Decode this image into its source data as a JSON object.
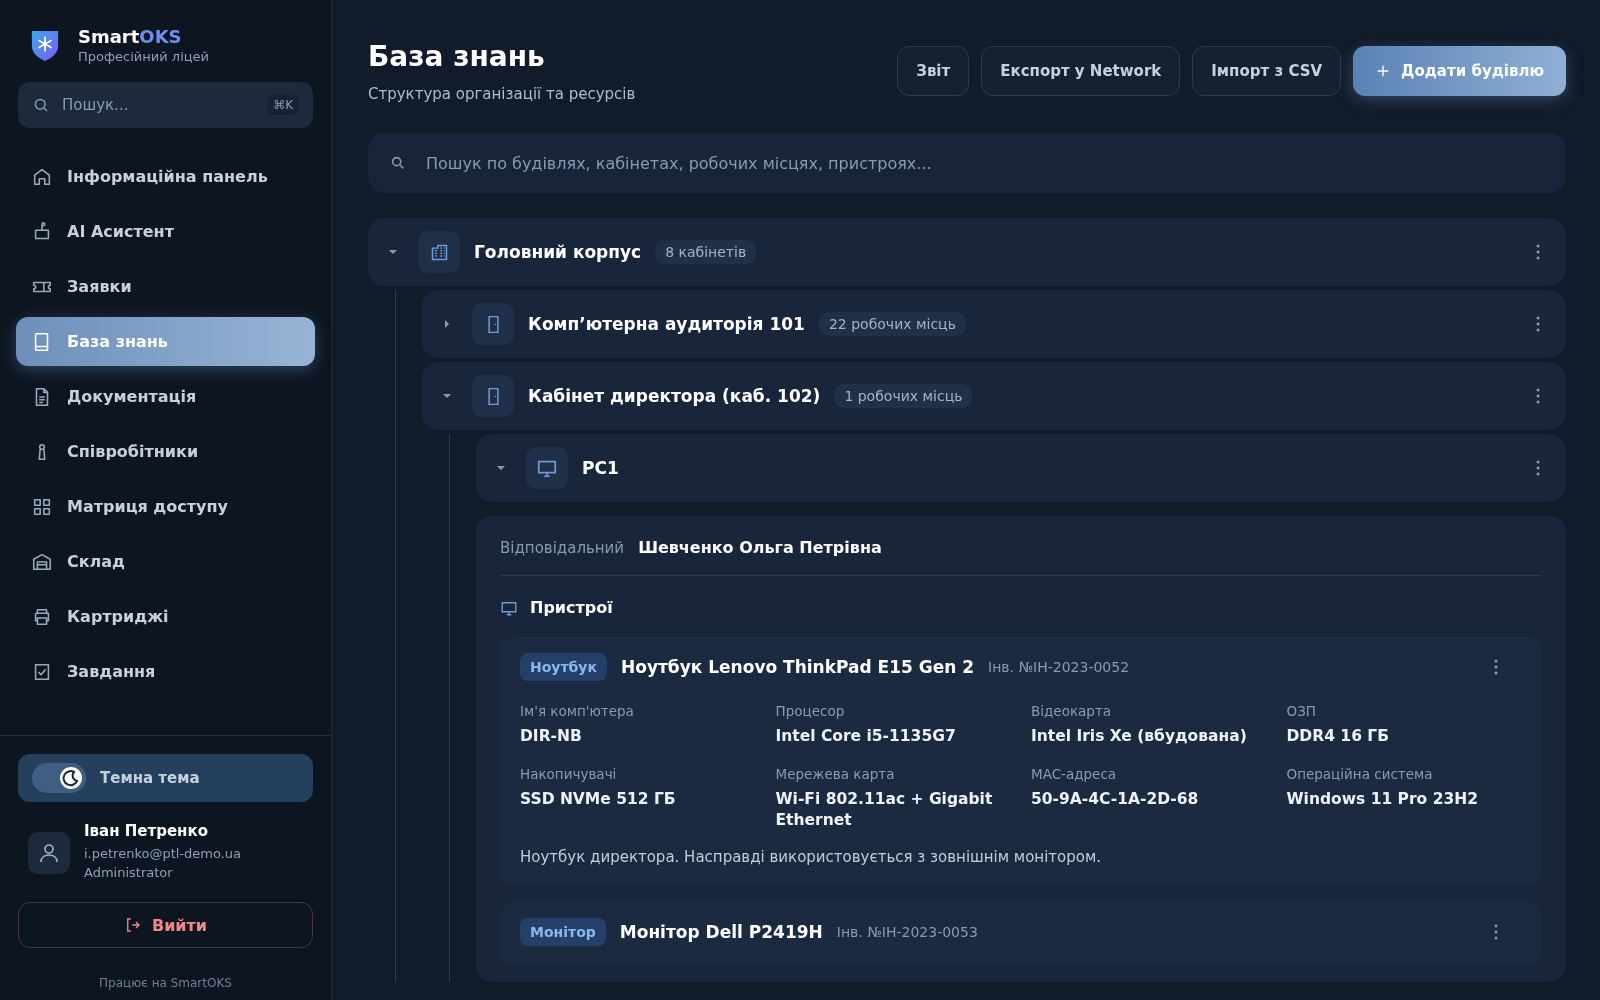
{
  "sidebar": {
    "brand": {
      "name": "Smart",
      "accent": "OKS",
      "subtitle": "Професійний ліцей"
    },
    "search": {
      "placeholder": "Пошук...",
      "shortcut": "⌘K"
    },
    "nav": [
      {
        "label": "Інформаційна панель",
        "selected": false
      },
      {
        "label": "AI Асистент",
        "selected": false
      },
      {
        "label": "Заявки",
        "selected": false
      },
      {
        "label": "База знань",
        "selected": true
      },
      {
        "label": "Документація",
        "selected": false
      },
      {
        "label": "Співробітники",
        "selected": false
      },
      {
        "label": "Матриця доступу",
        "selected": false
      },
      {
        "label": "Склад",
        "selected": false
      },
      {
        "label": "Картриджі",
        "selected": false
      },
      {
        "label": "Завдання",
        "selected": false
      }
    ],
    "theme_toggle": {
      "label": "Темна тема",
      "on": true
    },
    "user": {
      "name": "Іван Петренко",
      "email": "i.petrenko@ptl-demo.ua",
      "role": "Administrator"
    },
    "logout": "Вийти",
    "footer": "Працює на SmartOKS"
  },
  "header": {
    "title": "База знань",
    "subtitle": "Структура організації та ресурсів",
    "buttons": [
      {
        "label": "Звіт",
        "primary": false
      },
      {
        "label": "Експорт у Network",
        "primary": false
      },
      {
        "label": "Імпорт з CSV",
        "primary": false
      },
      {
        "label": "Додати будівлю",
        "primary": true
      }
    ]
  },
  "search": {
    "placeholder": "Пошук по будівлях, кабінетах, робочих місцях, пристроях..."
  },
  "tree": [
    {
      "kind": "building",
      "name": "Головний корпус",
      "badge": "8 кабінетів",
      "expanded": true,
      "children": [
        {
          "kind": "room",
          "name": "Комп’ютерна аудиторія 101",
          "badge": "22 робочих місць",
          "expanded": false
        },
        {
          "kind": "room",
          "name": "Кабінет директора (каб. 102)",
          "badge": "1 робочих місць",
          "expanded": true,
          "children": [
            {
              "kind": "workstation",
              "name": "PC1",
              "expanded": true,
              "details": {
                "responsible_label": "Відповідальний",
                "responsible": "Шевченко Ольга Петрівна",
                "devices_title": "Пристрої",
                "devices": [
                  {
                    "type": "Ноутбук",
                    "name": "Ноутбук Lenovo ThinkPad E15 Gen 2",
                    "inventory": "Інв. №IH-2023-0052",
                    "specs": [
                      {
                        "label": "Ім'я комп'ютера",
                        "value": "DIR-NB"
                      },
                      {
                        "label": "Процесор",
                        "value": "Intel Core i5-1135G7"
                      },
                      {
                        "label": "Відеокарта",
                        "value": "Intel Iris Xe (вбудована)"
                      },
                      {
                        "label": "ОЗП",
                        "value": "DDR4 16 ГБ"
                      },
                      {
                        "label": "Накопичувачі",
                        "value": "SSD NVMe 512 ГБ"
                      },
                      {
                        "label": "Мережева карта",
                        "value": "Wi-Fi 802.11ac + Gigabit Ethernet"
                      },
                      {
                        "label": "MAC-адреса",
                        "value": "50-9A-4C-1A-2D-68"
                      },
                      {
                        "label": "Операційна система",
                        "value": "Windows 11 Pro 23H2"
                      }
                    ],
                    "note": "Ноутбук директора. Насправді використовується з зовнішнім монітором."
                  },
                  {
                    "type": "Монітор",
                    "name": "Монітор Dell P2419H",
                    "inventory": "Інв. №IH-2023-0053"
                  }
                ]
              }
            }
          ]
        }
      ]
    }
  ]
}
